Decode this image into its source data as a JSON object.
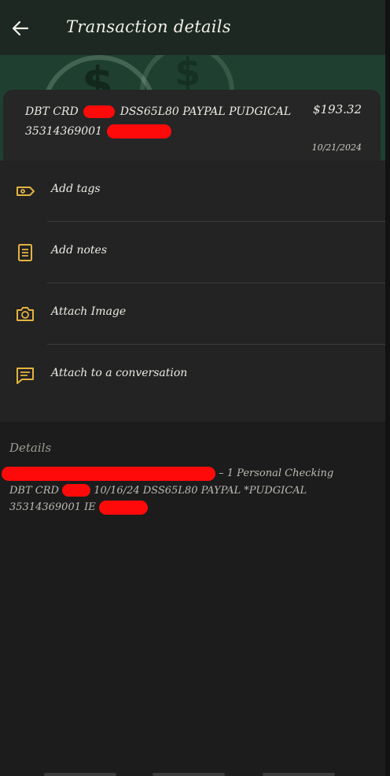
{
  "app_bar": {
    "title": "Transaction details",
    "back_icon": "arrow-left-icon",
    "bg": "#1d2823"
  },
  "banner": {
    "icon": "dollar-coins-icon",
    "bg": "#1f4030"
  },
  "transaction": {
    "description_line1": "DBT CRD",
    "description_line1b": "DSS65L80 PAYPAL PUDGICAL",
    "description_line2": "35314369001",
    "amount": "$193.32",
    "date": "10/21/2024"
  },
  "actions": [
    {
      "label": "Add tags",
      "icon": "tag-icon"
    },
    {
      "label": "Add notes",
      "icon": "notes-icon"
    },
    {
      "label": "Attach Image",
      "icon": "camera-icon"
    },
    {
      "label": "Attach to a conversation",
      "icon": "message-icon"
    }
  ],
  "details": {
    "label": "Details",
    "account_suffix": "– 1 Personal Checking",
    "line2_prefix": "DBT CRD",
    "line2_rest": "10/16/24 DSS65L80 PAYPAL *PUDGICAL",
    "line3": "35314369001 IE"
  },
  "colors": {
    "accent": "#e3b341",
    "redaction": "#ff0a0a",
    "card_bg": "#262626"
  }
}
